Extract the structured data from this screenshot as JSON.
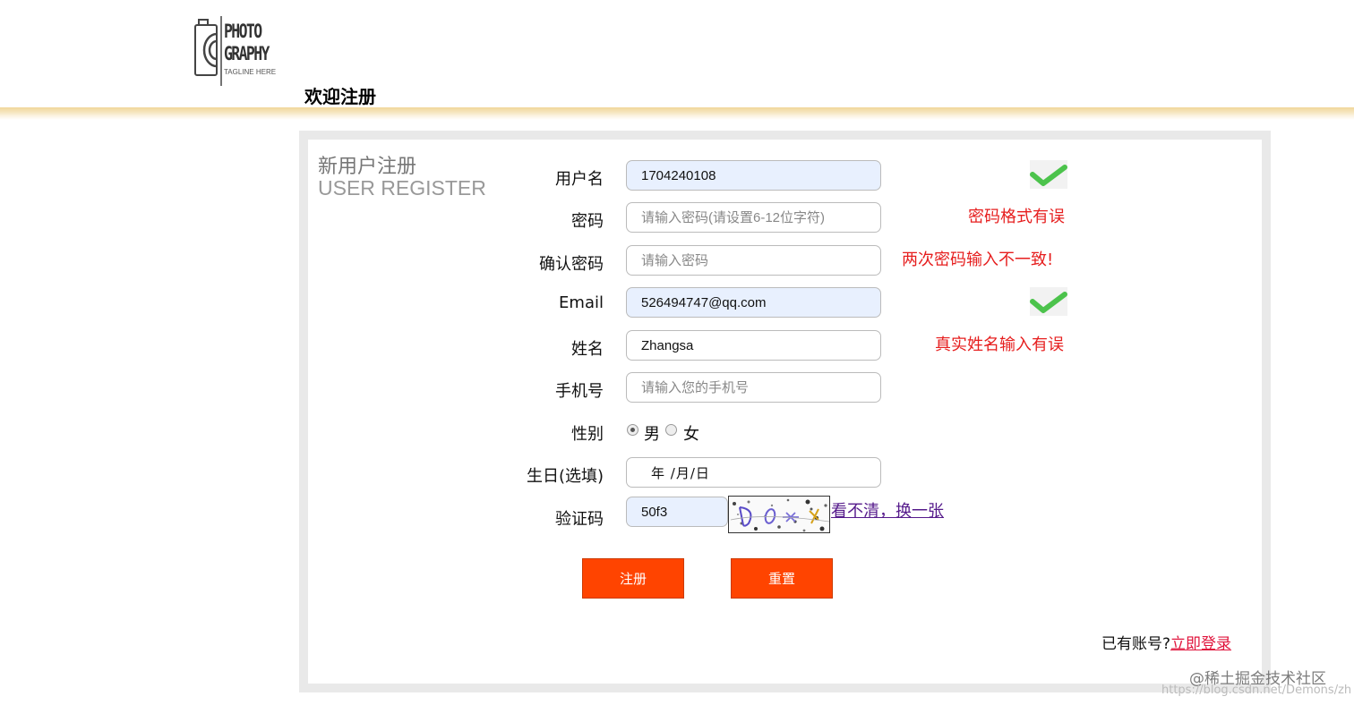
{
  "header": {
    "logo_line1": "PHOTO",
    "logo_line2": "GRAPHY",
    "logo_tagline": "TAGLINE HERE",
    "welcome": "欢迎注册"
  },
  "panel": {
    "title_cn": "新用户注册",
    "title_en": "USER REGISTER"
  },
  "form": {
    "username": {
      "label": "用户名",
      "value": "1704240108",
      "status": "valid"
    },
    "password": {
      "label": "密码",
      "value": "",
      "placeholder": "请输入密码(请设置6-12位字符)",
      "error": "密码格式有误"
    },
    "confirm_password": {
      "label": "确认密码",
      "value": "",
      "placeholder": "请输入密码",
      "error": "两次密码输入不一致!"
    },
    "email": {
      "label": "Email",
      "value": "526494747@qq.com",
      "status": "valid"
    },
    "realname": {
      "label": "姓名",
      "value": "Zhangsa",
      "error": "真实姓名输入有误"
    },
    "phone": {
      "label": "手机号",
      "value": "",
      "placeholder": "请输入您的手机号"
    },
    "gender": {
      "label": "性别",
      "options": [
        "男",
        "女"
      ],
      "selected": "男"
    },
    "birthday": {
      "label": "生日(选填)",
      "display": "年 /月/日"
    },
    "captcha": {
      "label": "验证码",
      "value": "50f3",
      "refresh_link": "看不清，换一张"
    }
  },
  "buttons": {
    "register": "注册",
    "reset": "重置"
  },
  "footer": {
    "account_prompt": "已有账号?",
    "login_link": "立即登录"
  },
  "watermark": {
    "line1": "@稀土掘金技术社区",
    "line2": "https://blog.csdn.net/Demons/zh"
  },
  "colors": {
    "accent_button": "#ff4400",
    "error_text": "#e61e1e",
    "check_green": "#4cc34c",
    "autofill_bg": "#e8f0fe",
    "header_shadow": "#f1d79a"
  },
  "icons": {
    "valid_status": "check-icon",
    "logo": "camera-icon"
  }
}
